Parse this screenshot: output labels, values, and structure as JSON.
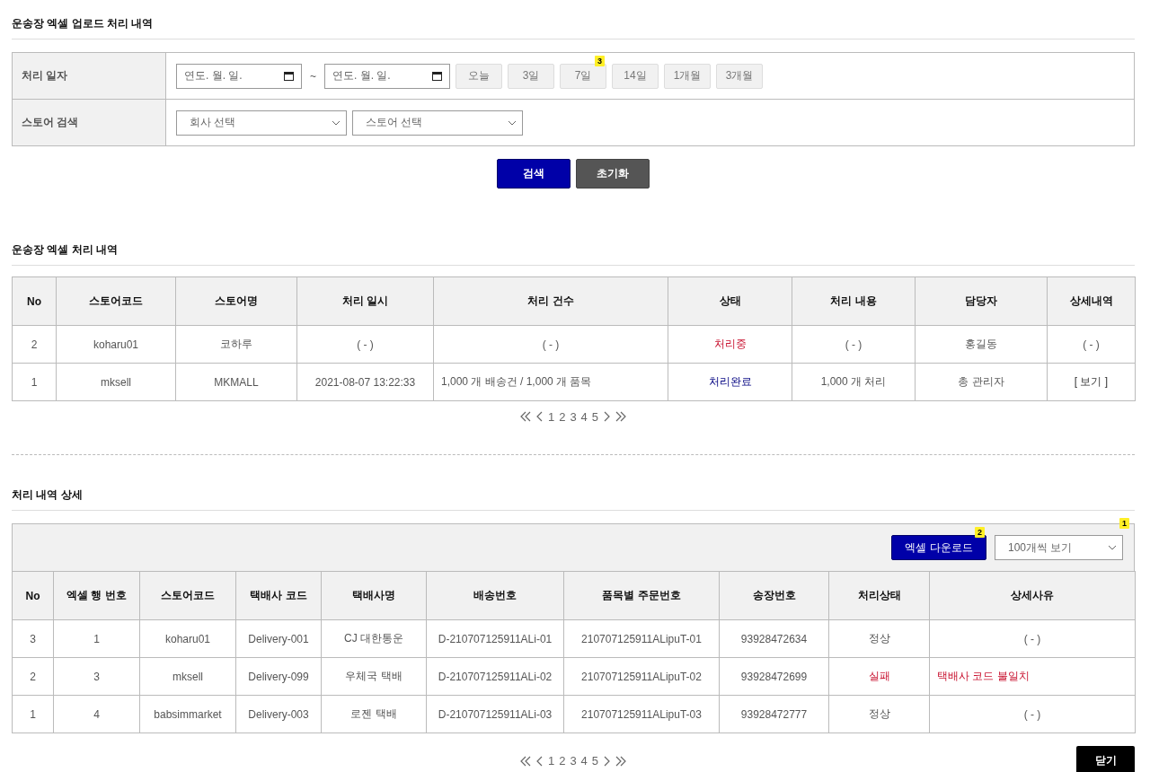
{
  "upload_section": {
    "title": "운송장 엑셀 업로드 처리 내역",
    "filters": {
      "date_label": "처리 일자",
      "date_from": {
        "placeholder": "연도. 월. 일."
      },
      "date_sep": "~",
      "date_to": {
        "placeholder": "연도. 월. 일."
      },
      "periods": [
        {
          "label": "오늘"
        },
        {
          "label": "3일"
        },
        {
          "label": "7일",
          "badge": "3"
        },
        {
          "label": "14일"
        },
        {
          "label": "1개월"
        },
        {
          "label": "3개월"
        }
      ],
      "store_label": "스토어 검색",
      "company_select": "회사 선택",
      "store_select": "스토어 선택"
    },
    "buttons": [
      {
        "label": "검색",
        "kind": "primary"
      },
      {
        "label": "초기화",
        "kind": "secondary"
      }
    ]
  },
  "history_section": {
    "title": "운송장 엑셀 처리 내역",
    "columns": [
      "No",
      "스토어코드",
      "스토어명",
      "처리 일시",
      "처리 건수",
      "상태",
      "처리 내용",
      "담당자",
      "상세내역"
    ],
    "rows": [
      {
        "no": "2",
        "store_code": "koharu01",
        "store_name": "코하루",
        "processed_at": "( - )",
        "count": {
          "text": "( - )",
          "kind": "empty"
        },
        "status": {
          "text": "처리중",
          "kind": "processing"
        },
        "content": "( - )",
        "manager": "홍길동",
        "detail": {
          "text": "( - )",
          "kind": "empty"
        }
      },
      {
        "no": "1",
        "store_code": "mksell",
        "store_name": "MKMALL",
        "processed_at": "2021-08-07 13:22:33",
        "count": {
          "text": "1,000 개 배송건 / 1,000 개 품목",
          "kind": "summary"
        },
        "status": {
          "text": "처리완료",
          "kind": "done"
        },
        "content": "1,000 개 처리",
        "manager": "총 관리자",
        "detail": {
          "text": "[ 보기 ]",
          "kind": "link"
        }
      }
    ],
    "pages": [
      "1",
      "2",
      "3",
      "4",
      "5"
    ]
  },
  "detail_section": {
    "title": "처리 내역 상세",
    "corner_badge": "1",
    "download_button": {
      "label": "엑셀 다운로드",
      "badge": "2"
    },
    "page_size_select": "100개씩 보기",
    "columns": [
      "No",
      "엑셀 행 번호",
      "스토어코드",
      "택배사 코드",
      "택배사명",
      "배송번호",
      "품목별 주문번호",
      "송장번호",
      "처리상태",
      "상세사유"
    ],
    "rows": [
      {
        "no": "3",
        "excel_row": "1",
        "store_code": "koharu01",
        "courier_code": "Delivery-001",
        "courier_name": "CJ 대한통운",
        "delivery_no": "D-210707125911ALi-01",
        "order_no": "210707125911ALipuT-01",
        "invoice_no": "93928472634",
        "status": {
          "text": "정상",
          "kind": "normal"
        },
        "reason": {
          "text": "( - )",
          "kind": "empty"
        }
      },
      {
        "no": "2",
        "excel_row": "3",
        "store_code": "mksell",
        "courier_code": "Delivery-099",
        "courier_name": "우체국 택배",
        "delivery_no": "D-210707125911ALi-02",
        "order_no": "210707125911ALipuT-02",
        "invoice_no": "93928472699",
        "status": {
          "text": "실패",
          "kind": "failed"
        },
        "reason": {
          "text": "택배사 코드 불일치",
          "kind": "error"
        }
      },
      {
        "no": "1",
        "excel_row": "4",
        "store_code": "babsimmarket",
        "courier_code": "Delivery-003",
        "courier_name": "로젠 택배",
        "delivery_no": "D-210707125911ALi-03",
        "order_no": "210707125911ALipuT-03",
        "invoice_no": "93928472777",
        "status": {
          "text": "정상",
          "kind": "normal"
        },
        "reason": {
          "text": "( - )",
          "kind": "empty"
        }
      }
    ],
    "pages": [
      "1",
      "2",
      "3",
      "4",
      "5"
    ],
    "close_button": "닫기"
  }
}
